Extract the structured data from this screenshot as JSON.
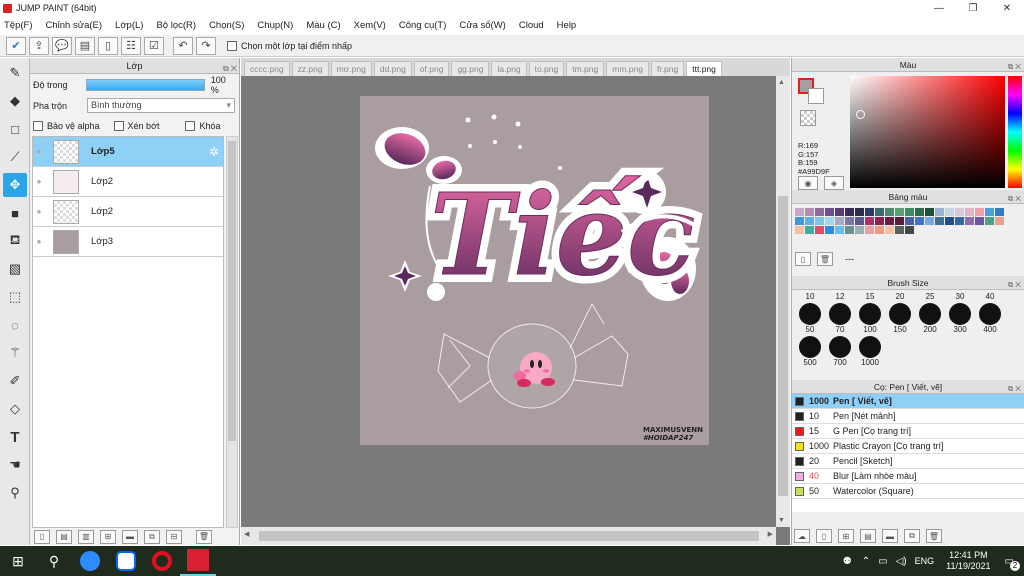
{
  "app": {
    "title": "JUMP PAINT (64bit)"
  },
  "menu": [
    "Tệp(F)",
    "Chỉnh sửa(E)",
    "Lớp(L)",
    "Bộ lọc(R)",
    "Chọn(S)",
    "Chụp(N)",
    "Màu (C)",
    "Xem(V)",
    "Công cụ(T)",
    "Cửa sổ(W)",
    "Cloud",
    "Help"
  ],
  "toolbar": {
    "pick_layer_label": "Chọn một lớp tại điểm nhấp"
  },
  "layer_panel": {
    "title": "Lớp",
    "opacity_label": "Độ trong",
    "opacity_value": "100 %",
    "opacity_fraction": 1.0,
    "blend_label": "Pha trộn",
    "blend_value": "Bình thường",
    "protect_alpha": "Bảo vệ alpha",
    "clipping": "Xén bớt",
    "lock": "Khóa",
    "layers": [
      {
        "name": "Lớp5",
        "selected": true
      },
      {
        "name": "Lớp2",
        "selected": false
      },
      {
        "name": "Lớp2",
        "selected": false
      },
      {
        "name": "Lớp3",
        "selected": false
      }
    ]
  },
  "tabs": [
    "cccc.png",
    "zz.png",
    "mơ.png",
    "dd.png",
    "of.png",
    "gg.png",
    "la.png",
    "to.png",
    "tm.png",
    "mm.png",
    "fr.png",
    "ttt.png"
  ],
  "active_tab": "ttt.png",
  "artwork": {
    "background": "#A99D9F",
    "title_text": "Tiếc",
    "signature_line1": "MAXIMUSVENN",
    "signature_line2": "#HOIDAP247"
  },
  "color_panel": {
    "title": "Màu",
    "r": "R:169",
    "g": "G:157",
    "b": "B:159",
    "hex": "#A99D9F"
  },
  "palette_panel": {
    "title": "Bảng màu",
    "name": "---",
    "swatches": [
      "#c7a6c9",
      "#b48cb4",
      "#8c6aa0",
      "#6d4f8d",
      "#583b75",
      "#3d2a5c",
      "#2c2b4a",
      "#2a3b5f",
      "#3c6b6e",
      "#4b8a6e",
      "#5aa070",
      "#3d8d5f",
      "#2c6c48",
      "#1f4f36",
      "#9ab3d0",
      "#c8d3e6",
      "#d8c8d8",
      "#e0b4c4",
      "#f0a0b0",
      "#4aa0d8",
      "#2e7fc0",
      "#3c9ad8",
      "#5fb0e0",
      "#7fc6ea",
      "#9fd8f0",
      "#a8a8c8",
      "#7a74a8",
      "#5e5890",
      "#b02c6a",
      "#8e1f52",
      "#6b1d48",
      "#5a1a3c",
      "#4a5ea8",
      "#3e73c6",
      "#70a8e0",
      "#3b6e96",
      "#1f4f86",
      "#306aa0",
      "#8e6cb0",
      "#6b5aa0",
      "#4c9f8d",
      "#e8a090",
      "#f0c0a0",
      "#3cb0a0",
      "#e04c6c",
      "#2c8ce0",
      "#60c0f0"
    ],
    "swatches_row3": [
      "#6e8f8f",
      "#9bb0b0",
      "#e6a0a0",
      "#f09880",
      "#f4c0a0",
      "#5a6060",
      "#404848"
    ]
  },
  "brush_size_panel": {
    "title": "Brush Size",
    "sizes_row1": [
      "10",
      "12",
      "15",
      "20",
      "25",
      "30",
      "40"
    ],
    "sizes_row2": [
      "50",
      "70",
      "100",
      "150",
      "200",
      "300",
      "400"
    ],
    "sizes_row3": [
      "500",
      "700",
      "1000"
    ]
  },
  "brush_panel": {
    "title": "Cọ: Pen [ Viết, vẽ]",
    "brushes": [
      {
        "size": "1000",
        "name": "Pen [ Viết, vẽ]",
        "color": "#222222",
        "selected": true
      },
      {
        "size": "10",
        "name": "Pen [Nét mảnh]",
        "color": "#222222",
        "selected": false
      },
      {
        "size": "15",
        "name": "G Pen [Cọ trang trí]",
        "color": "#e02020",
        "selected": false
      },
      {
        "size": "1000",
        "name": "Plastic Crayon [Cọ trang trí]",
        "color": "#f0e020",
        "selected": false
      },
      {
        "size": "20",
        "name": "Pencil [Sketch]",
        "color": "#222222",
        "selected": false
      },
      {
        "size": "40",
        "name": "Blur [Làm nhòe màu]",
        "color": "#f0b0e0",
        "selected": false
      },
      {
        "size": "50",
        "name": "Watercolor (Square)",
        "color": "#c8e060",
        "selected": false
      }
    ]
  },
  "taskbar": {
    "lang": "ENG",
    "time": "12:41 PM",
    "date": "11/19/2021",
    "notif_count": "2"
  }
}
